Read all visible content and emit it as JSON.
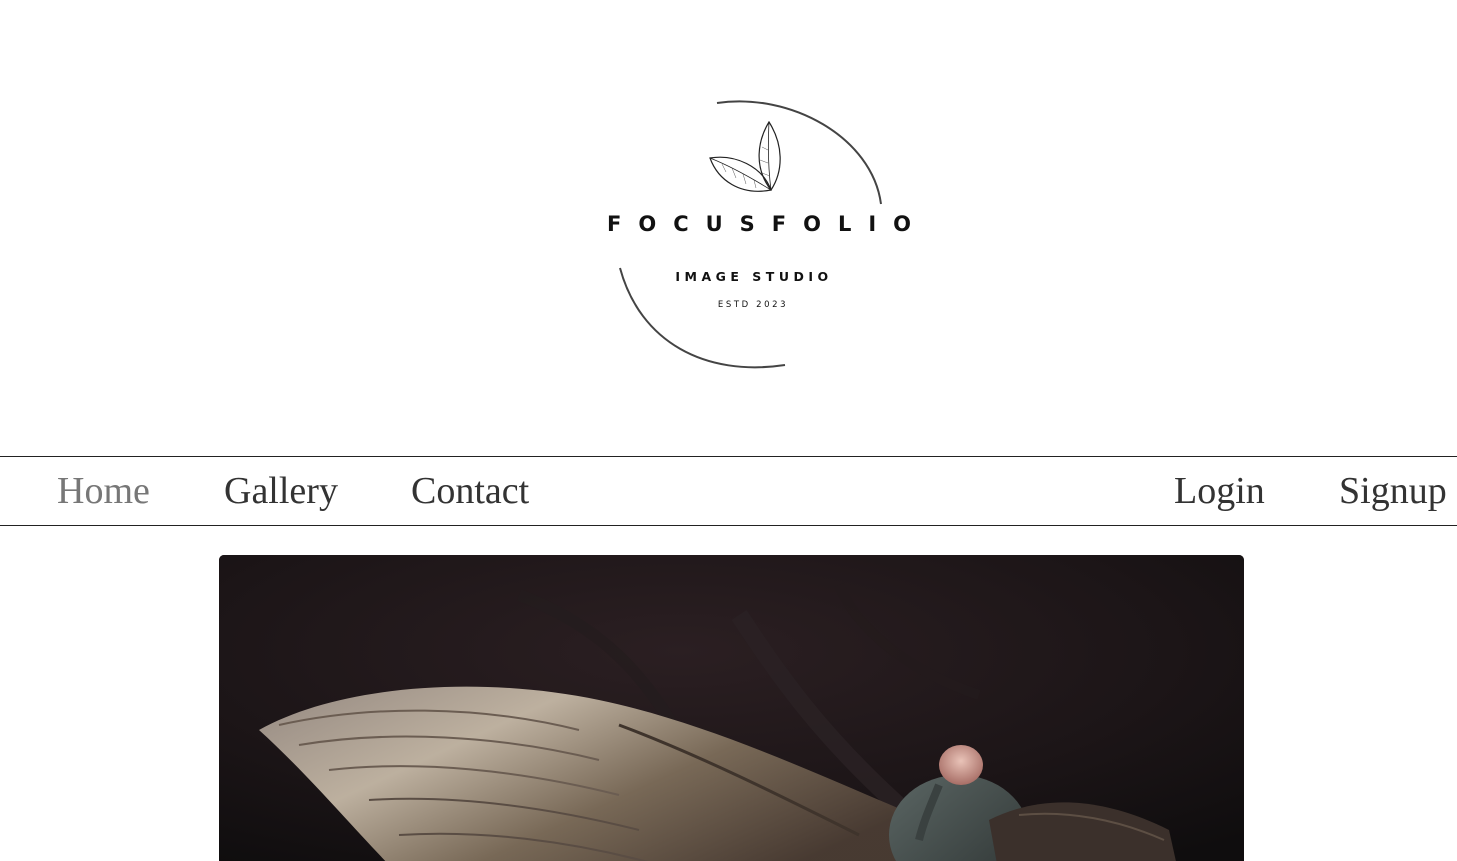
{
  "brand": {
    "name": "FOCUSFOLIO",
    "tagline": "IMAGE STUDIO",
    "established": "ESTD 2023",
    "logo_icon": "leaf-icon"
  },
  "nav": {
    "left": [
      {
        "label": "Home",
        "active": true
      },
      {
        "label": "Gallery",
        "active": false
      },
      {
        "label": "Contact",
        "active": false
      }
    ],
    "right": [
      {
        "label": "Login"
      },
      {
        "label": "Signup"
      }
    ]
  },
  "hero": {
    "subject": "vulture-with-spread-wings"
  },
  "colors": {
    "nav_text": "#333333",
    "nav_active": "#777777",
    "border": "#222222",
    "hero_background": "#171314"
  }
}
